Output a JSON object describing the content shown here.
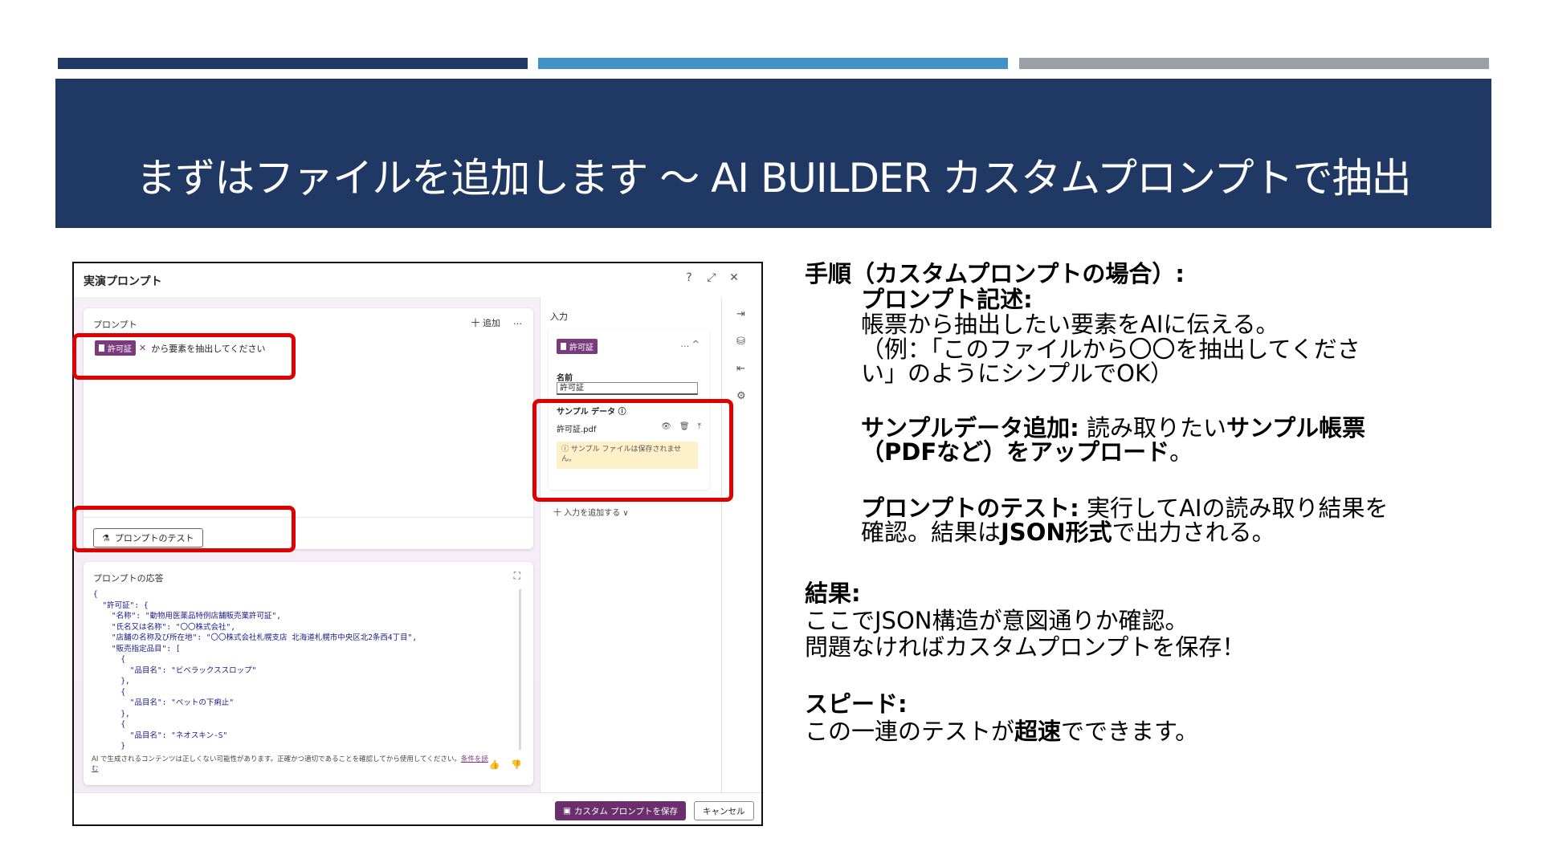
{
  "slide": {
    "title": "まずはファイルを追加します ～ AI BUILDER カスタムプロンプトで抽出"
  },
  "window": {
    "title": "実演プロンプト",
    "help_icon": "?",
    "expand_icon": "⤢",
    "close_icon": "✕"
  },
  "prompt_card": {
    "label": "プロンプト",
    "add_label": "十 追加",
    "more_label": "…",
    "chip_label": "許可証",
    "chip_close": "✕",
    "prompt_text": "から要素を抽出してください",
    "test_button": "プロンプトのテスト"
  },
  "response_card": {
    "label": "プロンプトの応答",
    "code": "{\n  \"許可証\": {\n    \"名称\": \"動物用医薬品特例店舗販売業許可証\",\n    \"氏名又は名称\": \"〇〇株式会社\",\n    \"店舗の名称及び所在地\": \"〇〇株式会社札幌支店 北海道札幌市中央区北2条西4丁目\",\n    \"販売指定品目\": [\n      {\n        \"品目名\": \"ビベラックススロップ\"\n      },\n      {\n        \"品目名\": \"ペットの下痢止\"\n      },\n      {\n        \"品目名\": \"ネオスキン-S\"\n      }",
    "disclaimer": "AI で生成されるコンテンツは正しくない可能性があります。正確かつ適切であることを確認してから使用してください。",
    "disclaimer_link": "条件を読む"
  },
  "input_pane": {
    "title": "入力",
    "chip_label": "許可証",
    "actions": "…  ^",
    "name_label": "名前",
    "name_value": "許可証",
    "sample_label": "サンプル データ ⓘ",
    "file_name": "許可証.pdf",
    "warning": "ⓘ サンプル ファイルは保存されません。",
    "add_input": "十 入力を追加する ∨"
  },
  "footer": {
    "save_button": "カスタム プロンプトを保存",
    "cancel_button": "キャンセル"
  },
  "notes": {
    "procedure_heading": "手順（カスタムプロンプトの場合）:",
    "step1_title": "プロンプト記述:",
    "step1_line1": "帳票から抽出したい要素をAIに伝える。",
    "step1_line2": "（例：「このファイルから〇〇を抽出してくださ",
    "step1_line3": "い」のようにシンプルでOK）",
    "step2_title": "サンプルデータ追加:",
    "step2_text_a": " 読み取りたい",
    "step2_bold_a": "サンプル帳票",
    "step2_bold_b": "（PDFなど）をアップロード",
    "step2_text_b": "。",
    "step3_title": "プロンプトのテスト:",
    "step3_text_a": " 実行してAIの読み取り結果を",
    "step3_text_b": "確認。結果は",
    "step3_bold": "JSON形式",
    "step3_text_c": "で出力される。",
    "result_heading": "結果:",
    "result_line1": "ここでJSON構造が意図通りか確認。",
    "result_line2": "問題なければカスタムプロンプトを保存！",
    "speed_heading": "スピード:",
    "speed_text_a": "この一連のテストが",
    "speed_bold": "超速",
    "speed_text_b": "でできます。"
  },
  "colors": {
    "navy": "#1f3864",
    "blue": "#4292c6",
    "gray": "#9aa0a6",
    "purple": "#6b2f6e",
    "highlight_red": "#e00000"
  }
}
